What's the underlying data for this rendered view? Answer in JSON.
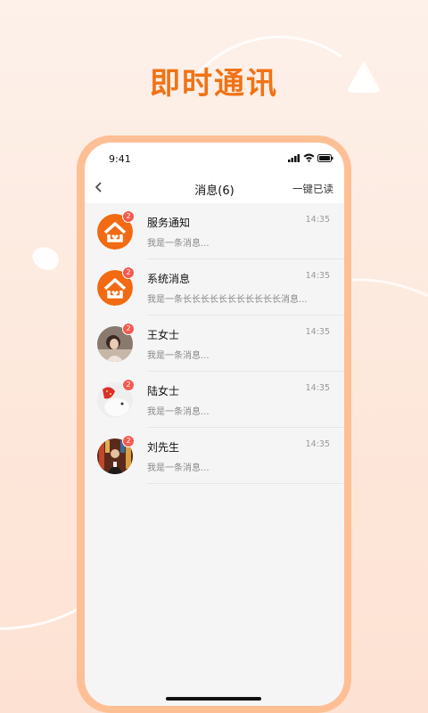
{
  "headline": "即时通讯",
  "status_bar": {
    "time": "9:41"
  },
  "navbar": {
    "title": "消息(6)",
    "action": "一键已读"
  },
  "messages": [
    {
      "name": "服务通知",
      "time": "14:35",
      "preview": "我是一条消息...",
      "badge": "2",
      "avatar": "house-logo"
    },
    {
      "name": "系统消息",
      "time": "14:35",
      "preview": "我是一条长长长长长长长长长长长消息...",
      "badge": "2",
      "avatar": "house-logo"
    },
    {
      "name": "王女士",
      "time": "14:35",
      "preview": "我是一条消息...",
      "badge": "2",
      "avatar": "user-photo"
    },
    {
      "name": "陆女士",
      "time": "14:35",
      "preview": "我是一条消息...",
      "badge": "2",
      "avatar": "user-photo"
    },
    {
      "name": "刘先生",
      "time": "14:35",
      "preview": "我是一条消息...",
      "badge": "2",
      "avatar": "user-photo"
    }
  ],
  "colors": {
    "accent": "#f07316",
    "phone_frame": "#ffbf95",
    "badge": "#f55a4e"
  }
}
